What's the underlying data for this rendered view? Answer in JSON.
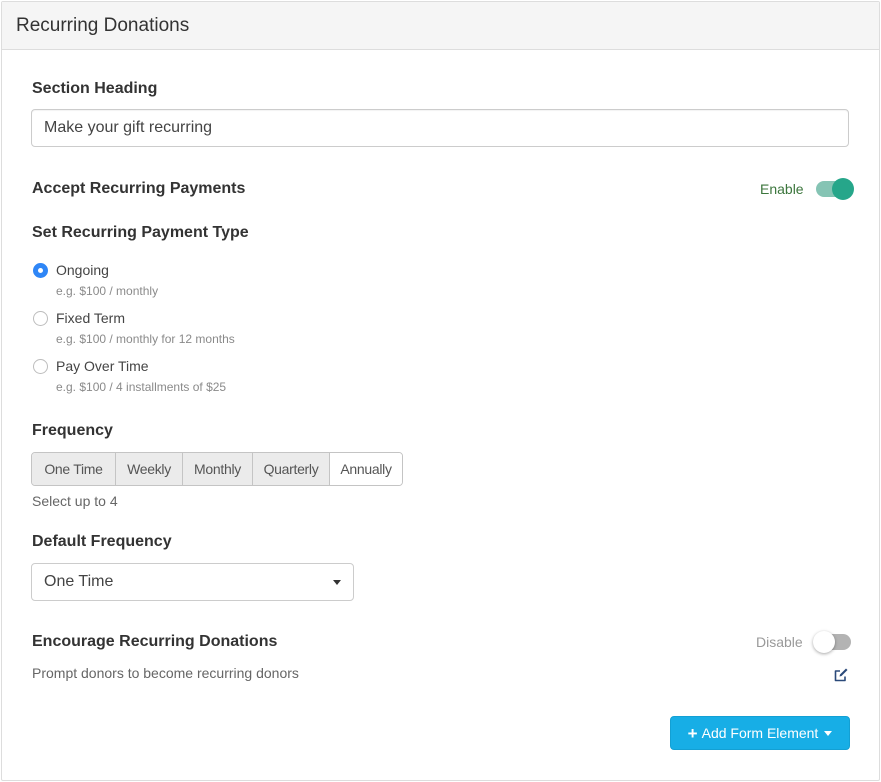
{
  "panel": {
    "title": "Recurring Donations"
  },
  "section_heading": {
    "label": "Section Heading",
    "value": "Make your gift recurring"
  },
  "accept_recurring": {
    "label": "Accept Recurring Payments",
    "toggle_label": "Enable",
    "enabled": true,
    "colors": {
      "on_knob": "#26a68a",
      "on_track": "#85c4b4",
      "label": "#3c763d"
    }
  },
  "payment_type": {
    "label": "Set Recurring Payment Type",
    "options": [
      {
        "label": "Ongoing",
        "help": "e.g. $100 / monthly",
        "checked": true
      },
      {
        "label": "Fixed Term",
        "help": "e.g. $100 / monthly for 12 months",
        "checked": false
      },
      {
        "label": "Pay Over Time",
        "help": "e.g. $100 / 4 installments of $25",
        "checked": false
      }
    ]
  },
  "frequency": {
    "label": "Frequency",
    "options": [
      {
        "label": "One Time",
        "active": true
      },
      {
        "label": "Weekly",
        "active": true
      },
      {
        "label": "Monthly",
        "active": true
      },
      {
        "label": "Quarterly",
        "active": true
      },
      {
        "label": "Annually",
        "active": false
      }
    ],
    "help": "Select up to 4"
  },
  "default_frequency": {
    "label": "Default Frequency",
    "selected": "One Time"
  },
  "encourage": {
    "label": "Encourage Recurring Donations",
    "description": "Prompt donors to become recurring donors",
    "toggle_label": "Disable",
    "enabled": false,
    "edit_icon": "edit-icon"
  },
  "add_button": {
    "icon": "plus-icon",
    "label": "Add Form Element",
    "color": "#17aee6"
  }
}
